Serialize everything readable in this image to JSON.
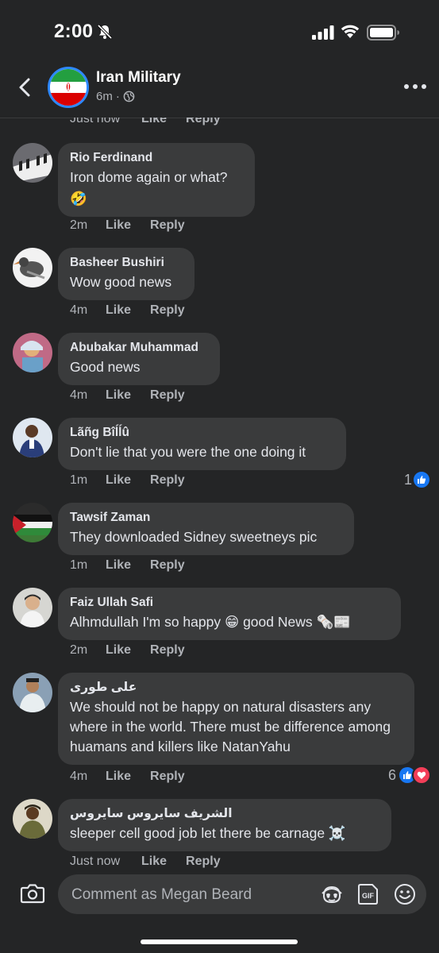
{
  "status_bar": {
    "time": "2:00"
  },
  "header": {
    "page_name": "Iran Military",
    "post_age": "6m",
    "dot": "·"
  },
  "clipped_top_actions": {
    "time": "Just now",
    "like": "Like",
    "reply": "Reply"
  },
  "comments": [
    {
      "author": "Rio Ferdinand",
      "text": "Iron dome again or what?",
      "emoji": "🤣",
      "time": "2m",
      "like": "Like",
      "reply": "Reply"
    },
    {
      "author": "Basheer Bushiri",
      "text": "Wow good news",
      "time": "4m",
      "like": "Like",
      "reply": "Reply"
    },
    {
      "author": "Abubakar Muhammad",
      "text": "Good news",
      "time": "4m",
      "like": "Like",
      "reply": "Reply"
    },
    {
      "author": "Lãñg Bîĺĺû",
      "text": "Don't lie that you were the one doing it",
      "time": "1m",
      "like": "Like",
      "reply": "Reply",
      "reaction_count": "1"
    },
    {
      "author": "Tawsif Zaman",
      "text": "They downloaded Sidney sweetneys pic",
      "time": "1m",
      "like": "Like",
      "reply": "Reply"
    },
    {
      "author": "Faiz Ullah Safi",
      "text": "Alhmdullah I'm so happy 😁 good News 🗞️📰",
      "time": "2m",
      "like": "Like",
      "reply": "Reply"
    },
    {
      "author": "علی طوری",
      "text": "We should not be happy on natural disasters any where in the world. There must be difference among huamans and killers like NatanYahu",
      "time": "4m",
      "like": "Like",
      "reply": "Reply",
      "reaction_count": "6"
    },
    {
      "author": "الشريف سايروس سايروس",
      "text": "sleeper cell good job let there be carnage ☠️",
      "time": "Just now",
      "like": "Like",
      "reply": "Reply"
    }
  ],
  "composer": {
    "placeholder": "Comment as Megan Beard"
  },
  "colors": {
    "background": "#242526",
    "bubble": "#3a3b3c",
    "like_blue": "#1877f2",
    "love_red": "#f33e58",
    "accent_ring": "#2d88ff"
  },
  "icons": [
    "bell-muted-icon",
    "signal-icon",
    "wifi-icon",
    "battery-icon",
    "back-icon",
    "globe-icon",
    "more-icon",
    "camera-icon",
    "avatar-sticker-icon",
    "gif-icon",
    "emoji-icon",
    "like-reaction-icon",
    "love-reaction-icon"
  ]
}
